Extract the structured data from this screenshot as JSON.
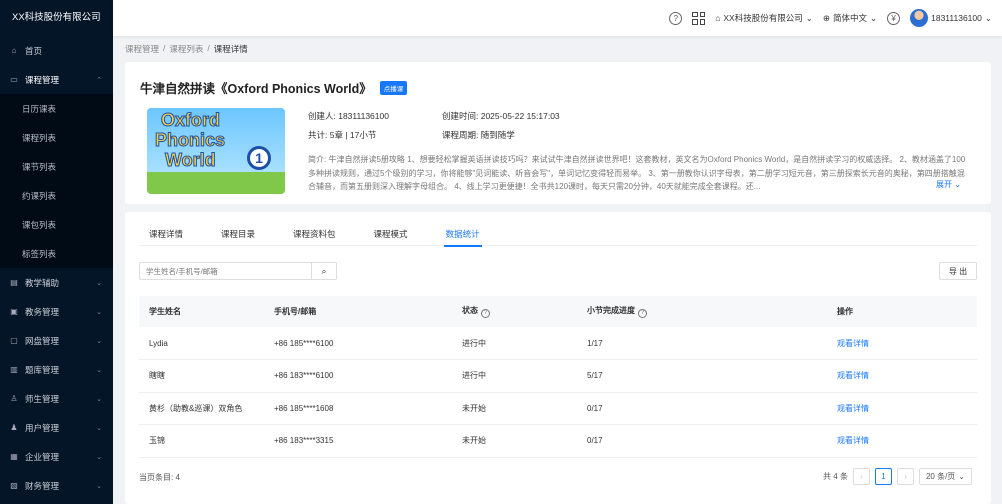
{
  "company_logo": "XX科技股份有限公司",
  "sidebar": {
    "items": [
      {
        "icon": "home-icon",
        "label": "首页"
      },
      {
        "icon": "course-icon",
        "label": "课程管理",
        "open": true,
        "children": [
          "日历课表",
          "课程列表",
          "课节列表",
          "约课列表",
          "课包列表",
          "标签列表"
        ]
      },
      {
        "icon": "teaching-icon",
        "label": "教学辅助"
      },
      {
        "icon": "affairs-icon",
        "label": "教务管理"
      },
      {
        "icon": "disk-icon",
        "label": "网盘管理"
      },
      {
        "icon": "question-bank-icon",
        "label": "题库管理"
      },
      {
        "icon": "teacher-icon",
        "label": "师生管理"
      },
      {
        "icon": "user-icon",
        "label": "用户管理"
      },
      {
        "icon": "enterprise-icon",
        "label": "企业管理"
      },
      {
        "icon": "finance-icon",
        "label": "财务管理"
      }
    ]
  },
  "header": {
    "company": "XX科技股份有限公司",
    "language": "简体中文",
    "currency_symbol": "¥",
    "user": "18311136100"
  },
  "breadcrumb": [
    "课程管理",
    "课程列表",
    "课程详情"
  ],
  "course": {
    "title": "牛津自然拼读《Oxford Phonics World》",
    "tag": "点播课",
    "cover_words": [
      "Oxford",
      "Phonics",
      "World"
    ],
    "cover_number": "1",
    "creator": "创建人: 18311136100",
    "created_time": "创建时间: 2025-05-22 15:17:03",
    "stats": "共计: 5章 | 17小节",
    "period": "课程周期: 随到随学",
    "intro": "简介: 牛津自然拼读5册攻略 1、想要轻松掌握英语拼读技巧吗？来试试牛津自然拼读世界吧！这套教材，英文名为Oxford Phonics World，是自然拼读学习的权威选择。 2、教材涵盖了100多种拼读规则，通过5个级别的学习，你将能够\"见词能读、听音会写\"，单词记忆变得轻而易举。 3、第一册教你认识字母表，第二册学习短元音，第三册探索长元音的奥秘，第四册搭触混合辅音，而第五册则深入理解字母组合。 4、线上学习更便捷！全书共120课时，每天只需20分钟，40天就能完成全套课程。还...",
    "expand": "展开"
  },
  "tabs": [
    "课程详情",
    "课程目录",
    "课程资料包",
    "课程模式",
    "数据统计"
  ],
  "active_tab": 4,
  "search": {
    "placeholder": "学生姓名/手机号/邮箱"
  },
  "export_label": "导 出",
  "table": {
    "headers": [
      "学生姓名",
      "手机号/邮箱",
      "状态",
      "小节完成进度",
      "操作"
    ],
    "rows": [
      {
        "name": "Lydia",
        "contact": "+86 185****6100",
        "status": "进行中",
        "progress": "1/17",
        "action": "观看详情"
      },
      {
        "name": "瞎瞎",
        "contact": "+86 183****6100",
        "status": "进行中",
        "progress": "5/17",
        "action": "观看详情"
      },
      {
        "name": "黄杉（助教&巡课）双角色",
        "contact": "+86 185****1608",
        "status": "未开始",
        "progress": "0/17",
        "action": "观看详情"
      },
      {
        "name": "玉锦",
        "contact": "+86 183****3315",
        "status": "未开始",
        "progress": "0/17",
        "action": "观看详情"
      }
    ]
  },
  "footer": {
    "current_count": "当页条目: 4",
    "total": "共 4 条",
    "page": "1",
    "page_size": "20 条/页"
  }
}
